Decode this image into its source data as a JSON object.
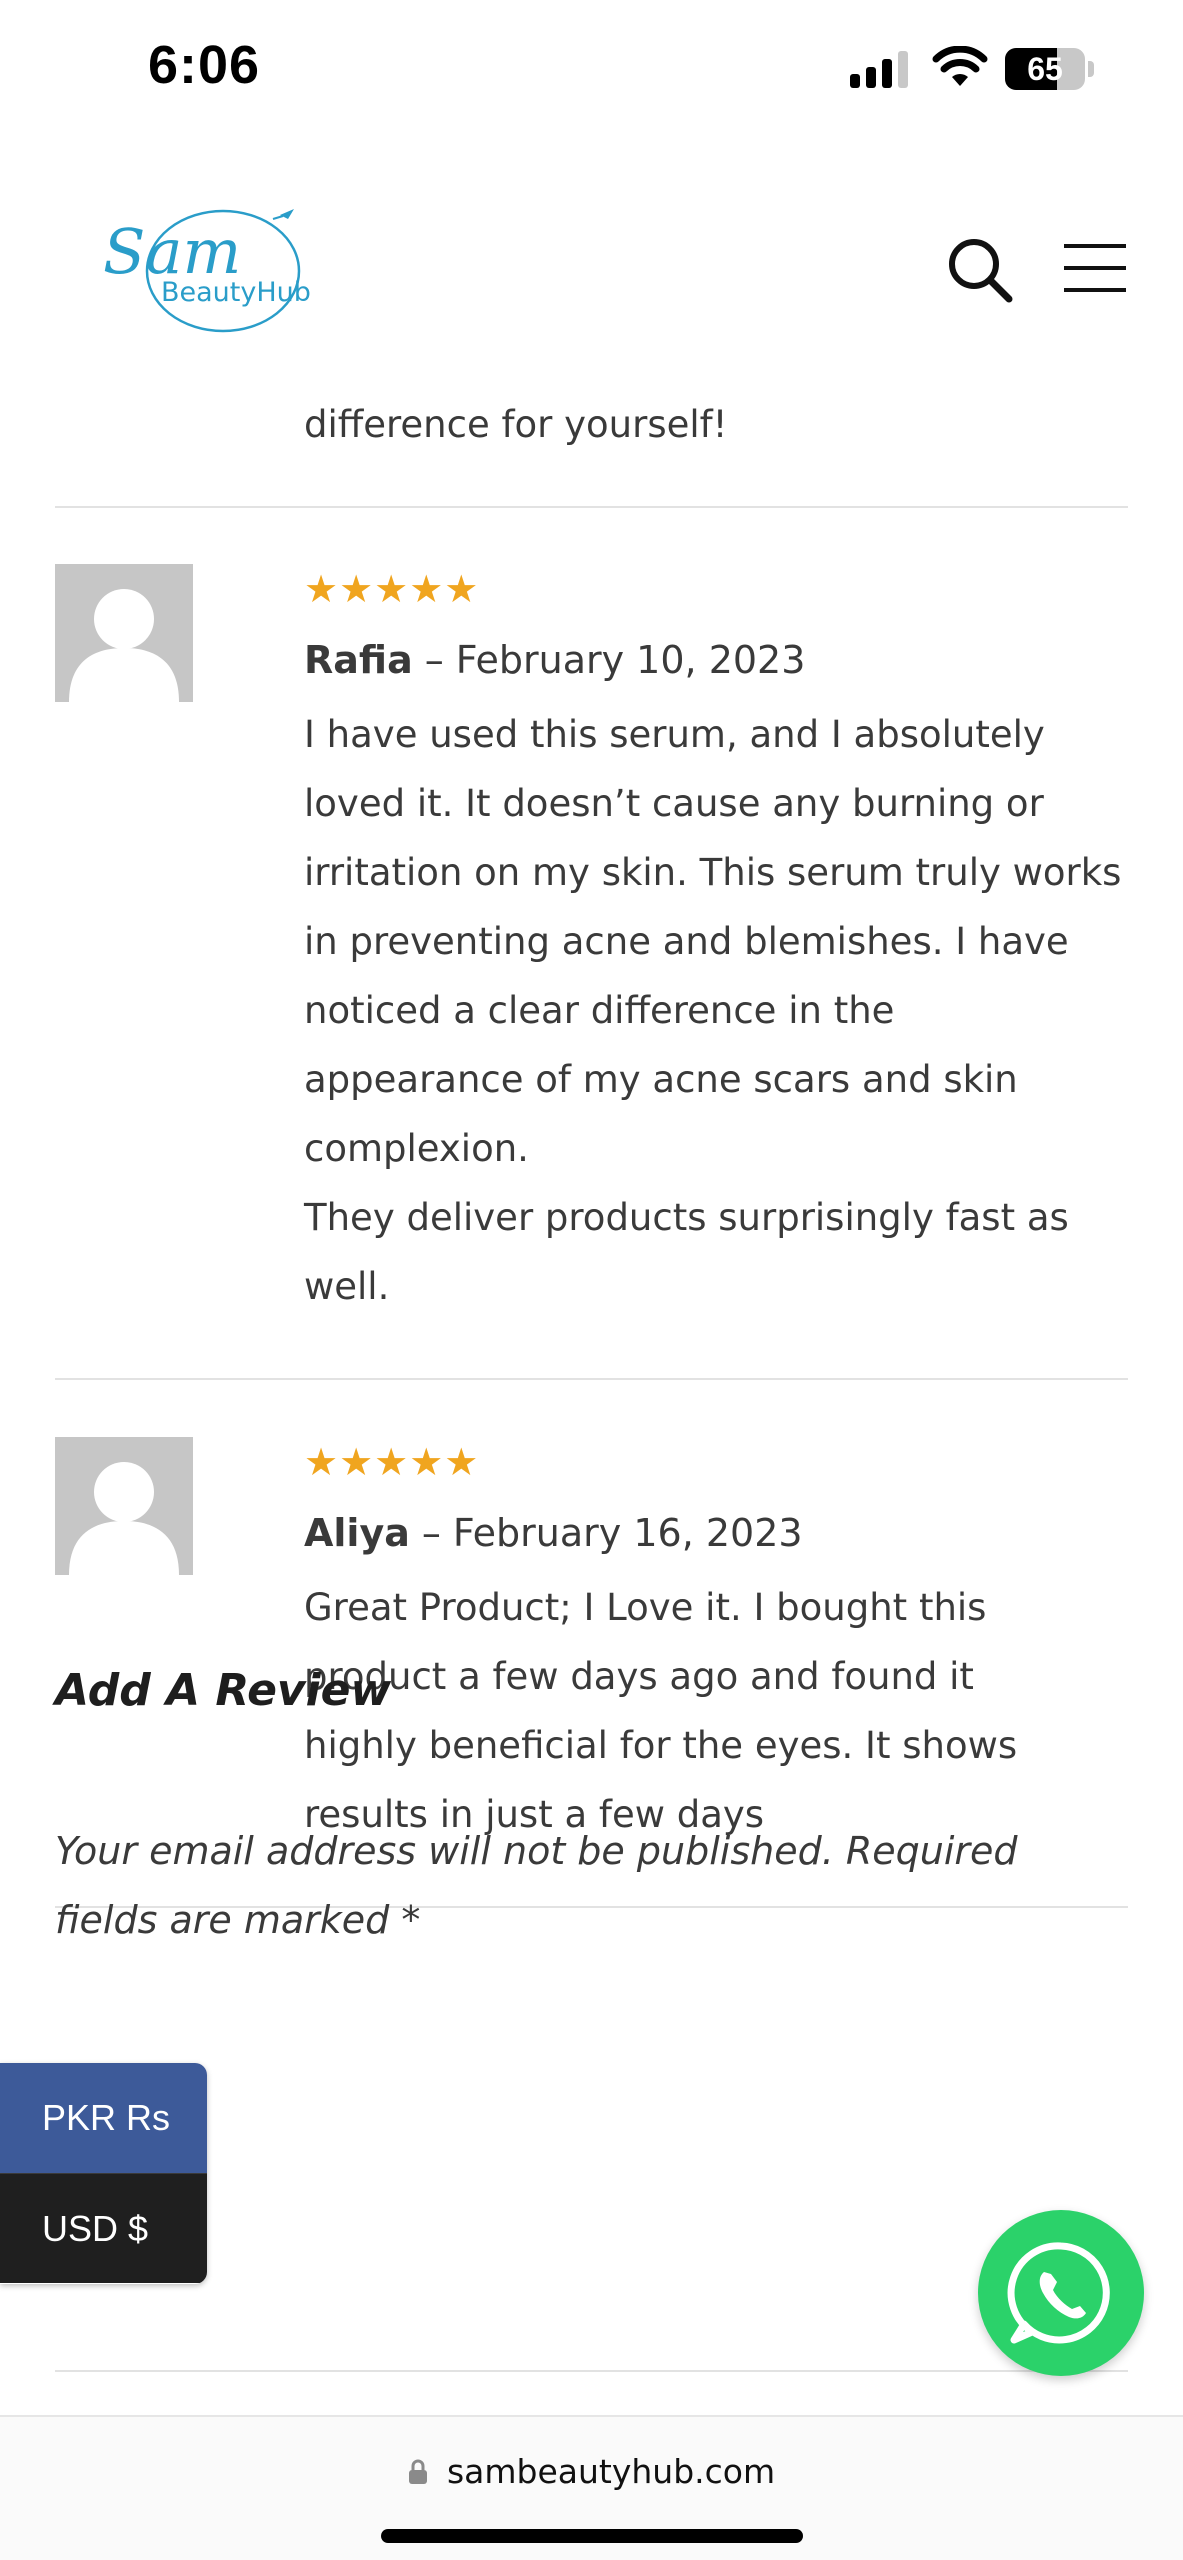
{
  "status_bar": {
    "time": "6:06",
    "battery": "65",
    "battery_level": 0.65
  },
  "header": {
    "logo_line1": "Sam",
    "logo_line2": "BeautyHub"
  },
  "previous_review_tail": "difference for yourself!",
  "reviews": [
    {
      "rating": 5,
      "stars": "★★★★★",
      "author": "Rafia",
      "separator": "–",
      "date": "February 10, 2023",
      "text": "I have used this serum, and I absolutely loved it. It doesn’t cause any burning or irritation on my skin. This serum truly works in preventing acne and blemishes. I have noticed a clear difference in the appearance of my acne scars and skin complexion.\nThey deliver products surprisingly fast as well."
    },
    {
      "rating": 5,
      "stars": "★★★★★",
      "author": "Aliya",
      "separator": "–",
      "date": "February 16, 2023",
      "text": "Great Product; I Love it. I bought this product a few days ago and found it highly beneficial for the eyes. It shows results in just a few days"
    }
  ],
  "add_review": {
    "title": "Add A Review",
    "notice": "Your email address will not be published. Required fields are marked *"
  },
  "currency": {
    "pkr": "PKR Rs",
    "usd": "USD $"
  },
  "browser": {
    "url": "sambeautyhub.com"
  },
  "colors": {
    "star": "#f0a51f",
    "whatsapp": "#2bd26a",
    "pkr_bg": "#3d5a99",
    "usd_bg": "#1f1f1f",
    "logo": "#2a9dc9"
  }
}
